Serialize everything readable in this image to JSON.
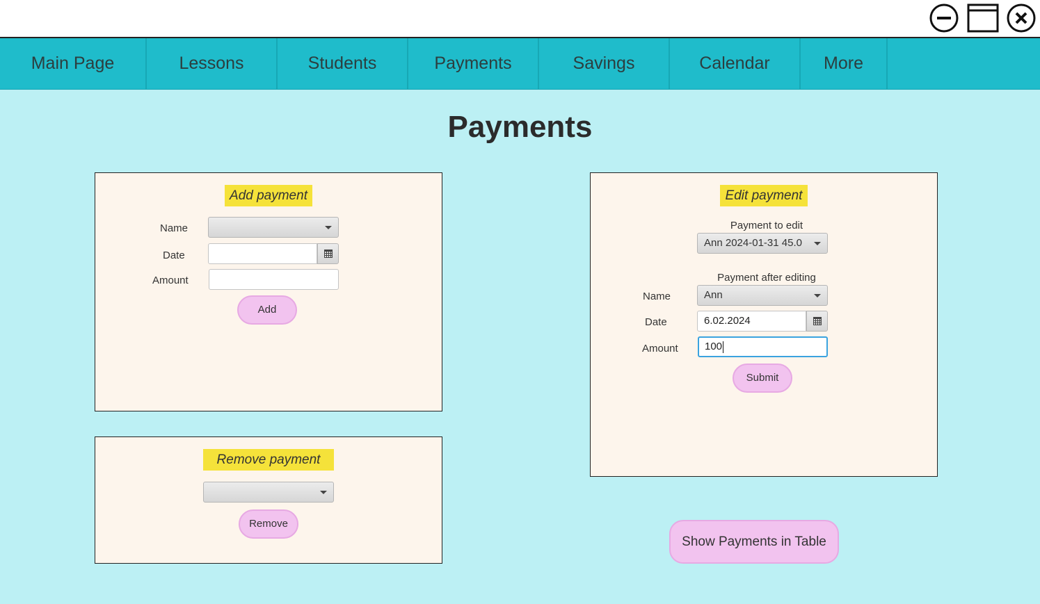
{
  "window_controls": {
    "minimize": "minimize-icon",
    "maximize": "maximize-icon",
    "close": "close-icon"
  },
  "nav": {
    "items": [
      {
        "label": "Main Page"
      },
      {
        "label": "Lessons"
      },
      {
        "label": "Students"
      },
      {
        "label": "Payments"
      },
      {
        "label": "Savings"
      },
      {
        "label": "Calendar"
      },
      {
        "label": "More"
      }
    ]
  },
  "page": {
    "title": "Payments"
  },
  "add_payment": {
    "heading": "Add payment",
    "name_label": "Name",
    "name_value": "",
    "date_label": "Date",
    "date_value": "",
    "amount_label": "Amount",
    "amount_value": "",
    "add_button": "Add"
  },
  "remove_payment": {
    "heading": "Remove payment",
    "selected_value": "",
    "remove_button": "Remove"
  },
  "edit_payment": {
    "heading": "Edit payment",
    "payment_to_edit_label": "Payment to edit",
    "payment_to_edit_value": "Ann 2024-01-31 45.0",
    "after_editing_label": "Payment after editing",
    "name_label": "Name",
    "name_value": "Ann",
    "date_label": "Date",
    "date_value": "6.02.2024",
    "amount_label": "Amount",
    "amount_value": "100",
    "submit_button": "Submit"
  },
  "show_table_button": "Show Payments in Table",
  "colors": {
    "background": "#bcf0f4",
    "nav": "#1fbccb",
    "panel": "#fdf5ec",
    "heading_highlight": "#f5e23a",
    "button": "#f2c3ef"
  }
}
